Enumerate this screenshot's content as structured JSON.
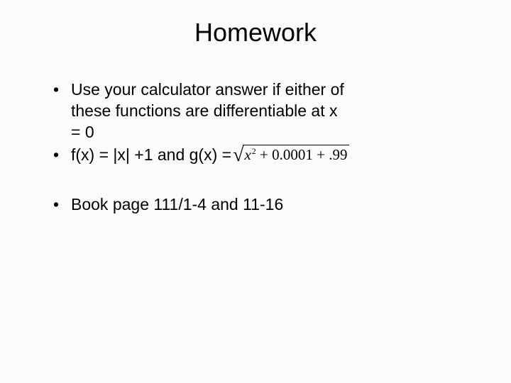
{
  "title": "Homework",
  "bullets": {
    "b1": "Use your calculator answer if either of these functions are differentiable at x = 0",
    "b2_prefix": "f(x) = |x| +1 and g(x) =",
    "b3": "Book page 111/1-4 and 11-16"
  },
  "formula": {
    "radicand_var": "x",
    "radicand_exp": "2",
    "radicand_mid": " + 0.0001 + .",
    "radicand_end": "99"
  }
}
